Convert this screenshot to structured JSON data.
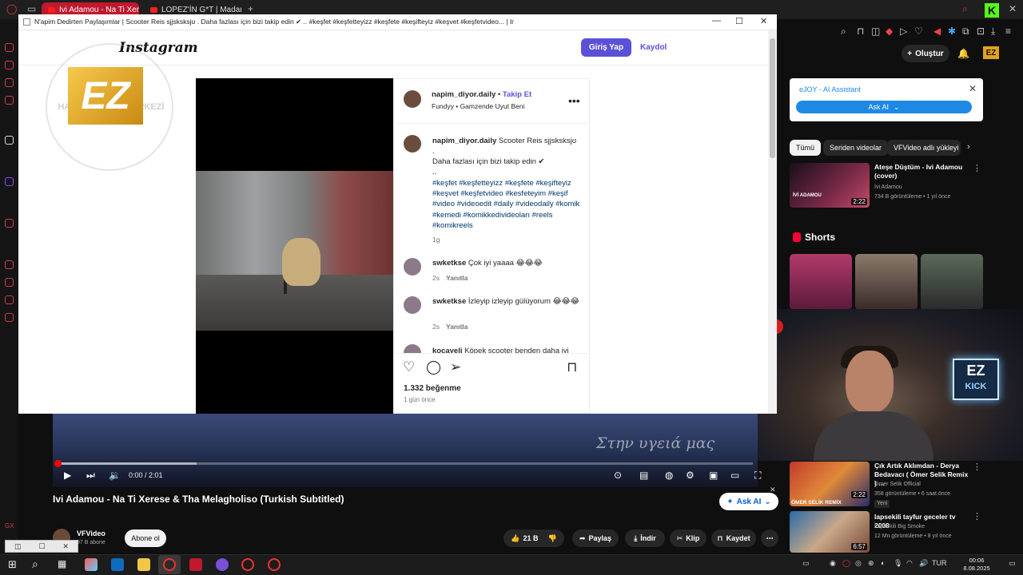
{
  "browser": {
    "tabs": [
      {
        "label": "Ivi Adamou - Na Ti Xerese",
        "active": true
      },
      {
        "label": "LOPEZ'İN G*T | Madara C",
        "active": false
      }
    ],
    "new_tab": "+"
  },
  "popup": {
    "window_title": "N'apim Dedirten Paylaşımlar | Scooter Reis sjjsksksjʊ . Daha fazlası için bizi takip edin ✔ .. #keşfet #keşfetteyizz #keşfete #keşifteyiz #keşvet #keşfetvideo... | Instagram",
    "controls": {
      "minimize": "—",
      "maximize": "☐",
      "close": "✕"
    }
  },
  "instagram": {
    "logo": "Instagram",
    "login_label": "Giriş Yap",
    "signup_label": "Kaydol",
    "post": {
      "username": "napim_diyor.daily",
      "follow_label": "Takip Et",
      "separator": "•",
      "audio": "Fundyy • Gamzende Uyut Beni",
      "caption_line1": "Scooter Reis sjjsksksjʊ",
      "dot1": ".",
      "caption_line2": "Daha fazlası için bizi takip edin ✔",
      "dot2": "..",
      "hashtags": "#keşfet #keşfetteyizz #keşfete #keşifteyiz #keşvet #keşfetvideo #kesfeteyim #keşif #video #videoedit #daily #videodaily #komik #kemedi #komikkedivideoları #reels #komikreels",
      "caption_age": "1g",
      "likes": "1.332 beğenme",
      "posted": "1 gün önce"
    },
    "comments": [
      {
        "user": "swketkse",
        "text": "Çok iyi yaaaa 😂😂😂",
        "age": "2s",
        "reply": "Yanıtla"
      },
      {
        "user": "swketkse",
        "text": "İzleyip izleyip gülüyorum 😂😂😂",
        "age": "2s",
        "reply": "Yanıtla"
      },
      {
        "user": "kocayeli",
        "text": "Köpek scooter benden daha iyi"
      }
    ]
  },
  "watermark": {
    "text": "RUH VE SİNİR HASTALIKLARI MERKEZİ",
    "logo": "EZ"
  },
  "youtube": {
    "create_label": "Oluştur",
    "ejoy": {
      "title": "eJOY - AI Assistant",
      "button": "Ask AI"
    },
    "chips": [
      "Tümü",
      "Seriden videolar",
      "VFVideo adlı yükleyi"
    ],
    "top_video": {
      "title": "Ateşe Düştüm - Ivi Adamou (cover)",
      "channel": "Ivi Adamou",
      "meta": "734 B görüntüleme • 1 yıl önce",
      "duration": "2:22",
      "thumb_text": "İVİ ADAMOU"
    },
    "shorts_label": "Shorts",
    "player": {
      "time": "0:00 / 2:01",
      "lyrics": "Στην υγειά μας",
      "progress": 0.0,
      "buffered": 0.2
    },
    "video_title": "Ivi Adamou - Na Ti Xerese & Tha Melagholiso (Turkish Subtitled)",
    "ask_ai": "Ask AI",
    "channel": {
      "name": "VFVideo",
      "subs": "97 B abone",
      "subscribe": "Abone ol"
    },
    "actions": {
      "likes": "21 B",
      "share": "Paylaş",
      "download": "İndir",
      "clip": "Klip",
      "save": "Kaydet"
    },
    "recommended": [
      {
        "title": "Çık Artık Aklımdan - Derya Bedavacı ( Ömer Selik Remix ) ...",
        "channel": "Ömer Selik Official",
        "meta": "358 görüntüleme • 6 saat önce",
        "badge": "Yeni",
        "duration": "2:22",
        "thumb_text": "ÖMER SELİK REMİX"
      },
      {
        "title": "lapsekili tayfur geceler tv 2000",
        "channel": "Lapsekili Big Smoke",
        "meta": "12 Mn görüntüleme • 8 yıl önce",
        "duration": "6:57"
      }
    ]
  },
  "webcam": {
    "overlay_top": "EZ",
    "overlay_bottom": "KICK"
  },
  "taskbar": {
    "lang": "TUR",
    "time": "00:06",
    "date": "8.08.2025"
  },
  "colors": {
    "instagram_blue": "#5b51d8",
    "youtube_red": "#ff0033",
    "tab_active": "#c0192e"
  }
}
